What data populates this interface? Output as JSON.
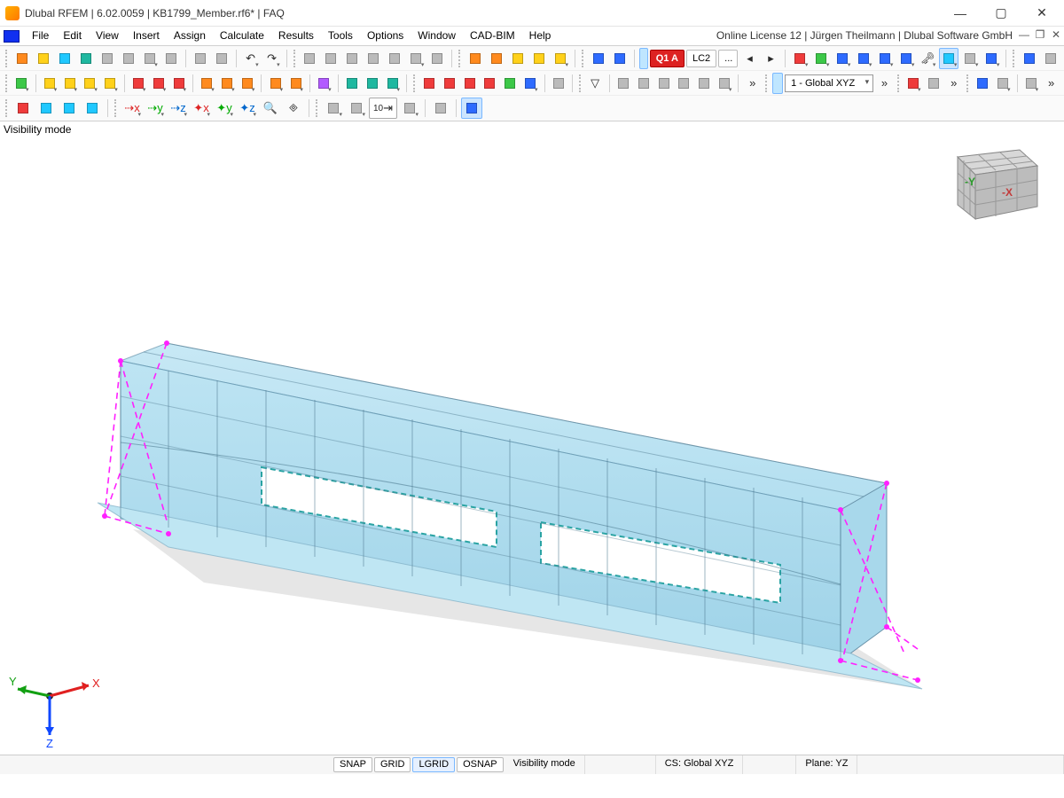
{
  "title": "Dlubal RFEM | 6.02.0059 | KB1799_Member.rf6* | FAQ",
  "license_text": "Online License 12 | Jürgen Theilmann | Dlubal Software GmbH",
  "menu": [
    "File",
    "Edit",
    "View",
    "Insert",
    "Assign",
    "Calculate",
    "Results",
    "Tools",
    "Options",
    "Window",
    "CAD-BIM",
    "Help"
  ],
  "viewport_label": "Visibility mode",
  "load_case_badge": "Q1 A",
  "load_case_text": "LC2",
  "load_case_dots": "...",
  "cs_combo": "1 - Global XYZ",
  "nav_axes": {
    "y": "-Y",
    "x": "-X"
  },
  "axis_triad": {
    "x": "X",
    "y": "Y",
    "z": "Z"
  },
  "status": {
    "snap": "SNAP",
    "grid": "GRID",
    "lgrid": "LGRID",
    "osnap": "OSNAP",
    "mode": "Visibility mode",
    "cs": "CS: Global XYZ",
    "plane": "Plane: YZ"
  },
  "row4_numeric": "10"
}
